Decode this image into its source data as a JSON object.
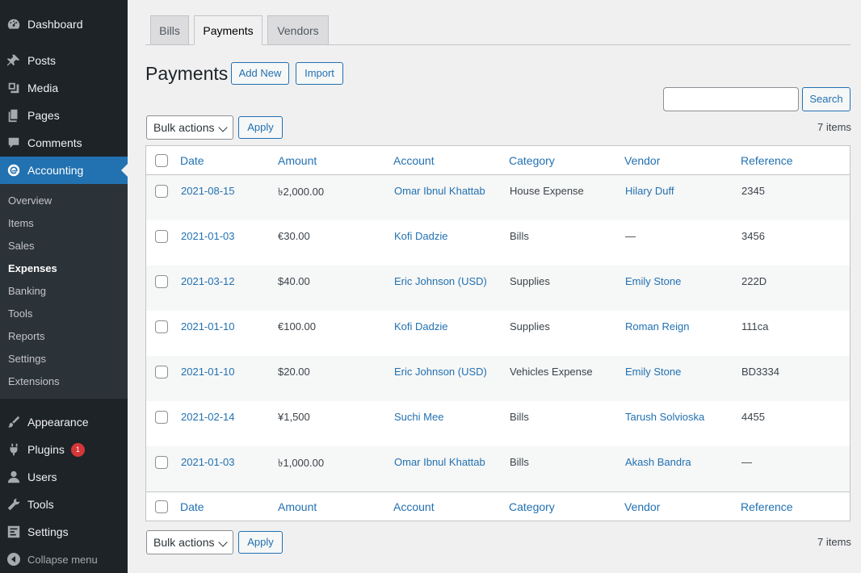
{
  "sidebar": {
    "top_items": [
      {
        "label": "Dashboard",
        "icon": "dashboard-icon"
      },
      {
        "label": "Posts",
        "icon": "pin-icon"
      },
      {
        "label": "Media",
        "icon": "media-icon"
      },
      {
        "label": "Pages",
        "icon": "pages-icon"
      },
      {
        "label": "Comments",
        "icon": "comment-icon"
      },
      {
        "label": "Accounting",
        "icon": "accounting-icon"
      }
    ],
    "submenu": [
      "Overview",
      "Items",
      "Sales",
      "Expenses",
      "Banking",
      "Tools",
      "Reports",
      "Settings",
      "Extensions"
    ],
    "bottom_items": [
      {
        "label": "Appearance",
        "icon": "brush-icon"
      },
      {
        "label": "Plugins",
        "icon": "plugin-icon",
        "badge": "1"
      },
      {
        "label": "Users",
        "icon": "users-icon"
      },
      {
        "label": "Tools",
        "icon": "wrench-icon"
      },
      {
        "label": "Settings",
        "icon": "settings-icon"
      }
    ],
    "collapse_label": "Collapse menu"
  },
  "tabs": [
    "Bills",
    "Payments",
    "Vendors"
  ],
  "page_title": "Payments",
  "add_new_label": "Add New",
  "import_label": "Import",
  "search": {
    "button_label": "Search",
    "value": ""
  },
  "bulk_actions": "Bulk actions",
  "apply_label": "Apply",
  "items_count": "7 items",
  "columns": [
    "Date",
    "Amount",
    "Account",
    "Category",
    "Vendor",
    "Reference"
  ],
  "rows": [
    {
      "date": "2021-08-15",
      "amount": "৳2,000.00",
      "account": "Omar Ibnul Khattab",
      "category": "House Expense",
      "vendor": "Hilary Duff",
      "reference": "2345"
    },
    {
      "date": "2021-01-03",
      "amount": "€30.00",
      "account": "Kofi Dadzie",
      "category": "Bills",
      "vendor": "—",
      "reference": "3456"
    },
    {
      "date": "2021-03-12",
      "amount": "$40.00",
      "account": "Eric Johnson (USD)",
      "category": "Supplies",
      "vendor": "Emily Stone",
      "reference": "222D"
    },
    {
      "date": "2021-01-10",
      "amount": "€100.00",
      "account": "Kofi Dadzie",
      "category": "Supplies",
      "vendor": "Roman Reign",
      "reference": "111ca"
    },
    {
      "date": "2021-01-10",
      "amount": "$20.00",
      "account": "Eric Johnson (USD)",
      "category": "Vehicles Expense",
      "vendor": "Emily Stone",
      "reference": "BD3334"
    },
    {
      "date": "2021-02-14",
      "amount": "¥1,500",
      "account": "Suchi Mee",
      "category": "Bills",
      "vendor": "Tarush Solvioska",
      "reference": "4455"
    },
    {
      "date": "2021-01-03",
      "amount": "৳1,000.00",
      "account": "Omar Ibnul Khattab",
      "category": "Bills",
      "vendor": "Akash Bandra",
      "reference": "—"
    }
  ]
}
